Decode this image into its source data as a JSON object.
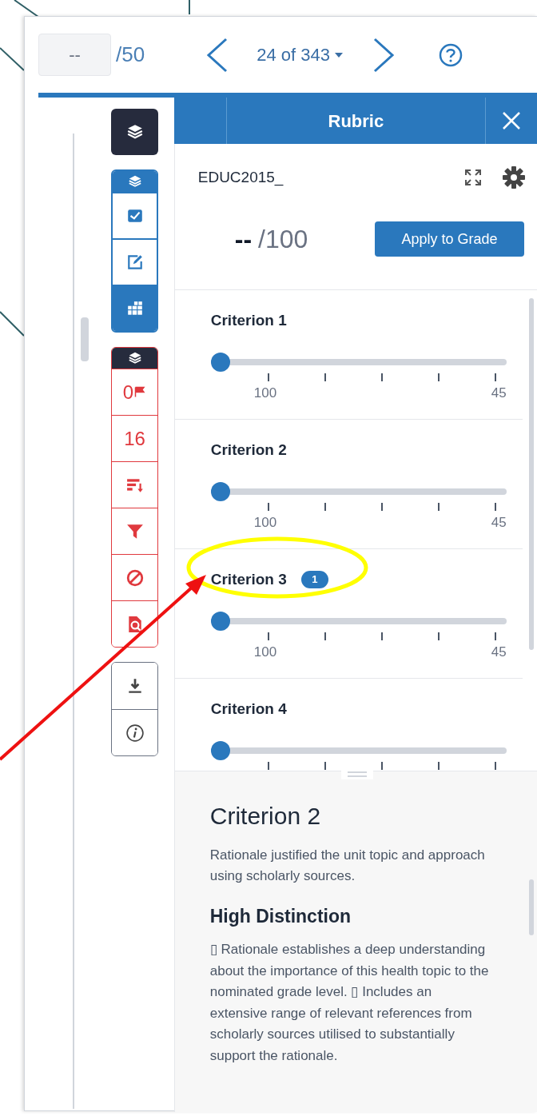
{
  "grade": {
    "value": "--",
    "max": "/50"
  },
  "pager": {
    "label": "24 of 343"
  },
  "rubric": {
    "title": "Rubric",
    "name": "EDUC2015_",
    "score": "--",
    "total": "/100",
    "apply_button": "Apply to Grade"
  },
  "toolbar": [
    {
      "kind": "dark",
      "items": [
        {
          "kind": "layers",
          "selected": false
        }
      ]
    },
    {
      "kind": "blue",
      "items": [
        {
          "kind": "check",
          "selected": false
        },
        {
          "kind": "edit",
          "selected": false
        },
        {
          "kind": "grid",
          "selected": true
        }
      ]
    },
    {
      "kind": "red",
      "items": [
        {
          "kind": "flag",
          "text": "0"
        },
        {
          "kind": "count",
          "text": "16"
        },
        {
          "kind": "sort"
        },
        {
          "kind": "filter"
        },
        {
          "kind": "ban"
        },
        {
          "kind": "doc-search"
        }
      ]
    },
    {
      "kind": "gray",
      "items": [
        {
          "kind": "download"
        },
        {
          "kind": "info"
        }
      ]
    }
  ],
  "criteria": [
    {
      "title": "Criterion 1",
      "level": 0,
      "scale_labels": [
        "100",
        "45"
      ]
    },
    {
      "title": "Criterion 2",
      "level": 0,
      "scale_labels": [
        "100",
        "45"
      ]
    },
    {
      "title": "Criterion 3",
      "comments": "1",
      "level": 0,
      "scale_labels": [
        "100",
        "45"
      ]
    },
    {
      "title": "Criterion 4",
      "level": 0
    }
  ],
  "detail": {
    "title": "Criterion 2",
    "description": "Rationale justified the unit topic and approach using scholarly sources.",
    "level_title": "High Distinction",
    "level_text": "▯ Rationale establishes a deep understanding about the importance of this health topic to the nominated grade level. ▯ Includes an extensive range of relevant references from scholarly sources utilised to substantially support the rationale."
  }
}
